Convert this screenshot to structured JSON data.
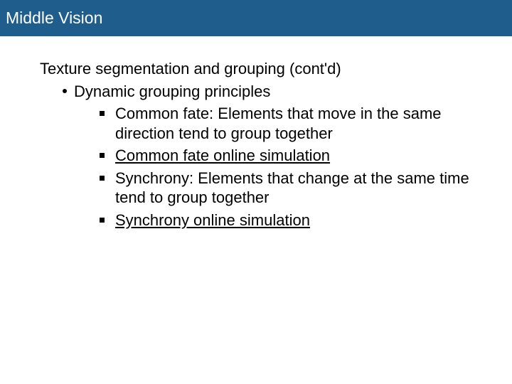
{
  "header": {
    "title": "Middle Vision"
  },
  "content": {
    "topic": "Texture segmentation and grouping (cont'd)",
    "sub": {
      "label": "Dynamic grouping principles",
      "items": [
        {
          "text": "Common fate: Elements that move in the same direction tend to group together",
          "is_link": false
        },
        {
          "text": "Common fate online simulation",
          "is_link": true
        },
        {
          "text": "Synchrony: Elements that change at the same time tend to group together",
          "is_link": false
        },
        {
          "text": "Synchrony online simulation",
          "is_link": true
        }
      ]
    }
  }
}
